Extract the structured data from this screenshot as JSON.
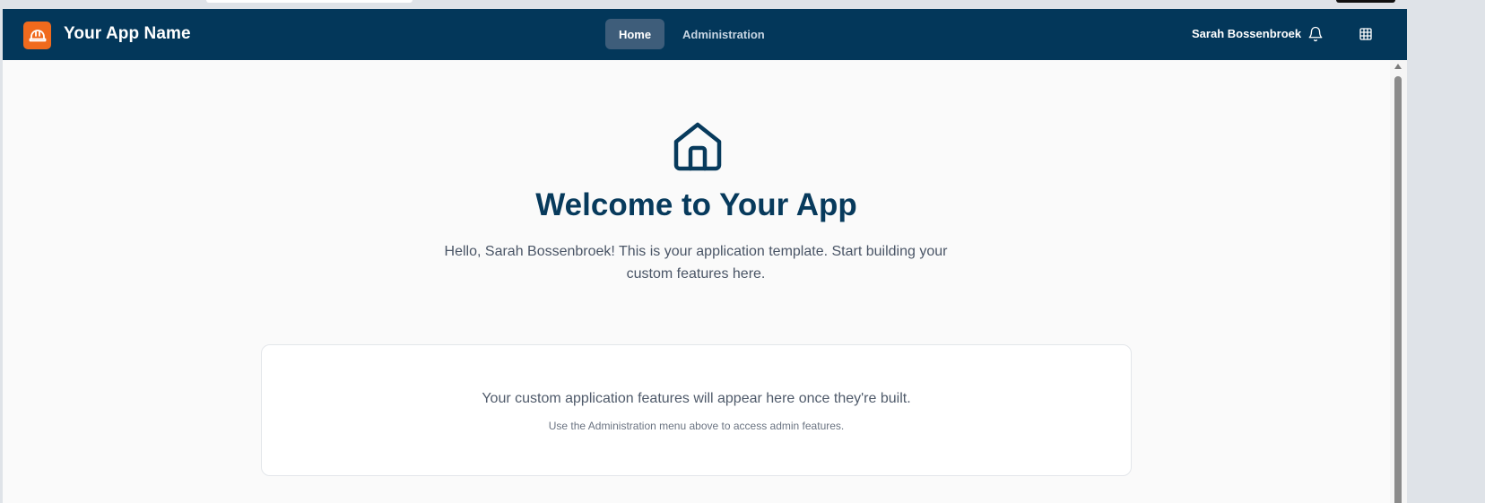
{
  "header": {
    "app_name": "Your App Name",
    "nav": [
      {
        "label": "Home",
        "active": true
      },
      {
        "label": "Administration",
        "active": false
      }
    ],
    "user_name": "Sarah Bossenbroek",
    "icons": {
      "logo": "hard-hat-icon",
      "notifications": "bell-icon",
      "apps": "grid-icon"
    }
  },
  "hero": {
    "icon": "home-icon",
    "title": "Welcome to Your App",
    "text": "Hello, Sarah Bossenbroek! This is your application template. Start building your custom features here."
  },
  "card": {
    "main_text": "Your custom application features will appear here once they're built.",
    "sub_text": "Use the Administration menu above to access admin features."
  },
  "colors": {
    "header_bg": "#03375a",
    "accent": "#f06a1d",
    "title": "#073a5c"
  }
}
